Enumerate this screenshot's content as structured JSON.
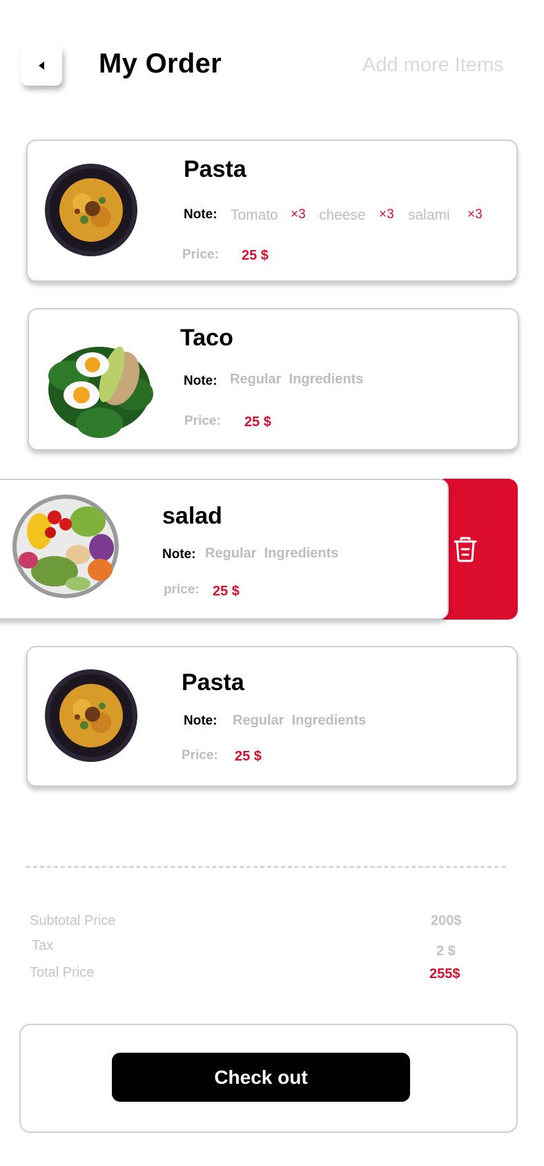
{
  "header": {
    "title": "My Order",
    "add_more_label": "Add more Items"
  },
  "orders": [
    {
      "name": "Pasta",
      "note_label": "Note:",
      "notes": [
        {
          "text": "Tomato",
          "qty": "×3"
        },
        {
          "text": "cheese",
          "qty": "×3"
        },
        {
          "text": "salami",
          "qty": "×3"
        }
      ],
      "price_label": "Price:",
      "price": "25 $"
    },
    {
      "name": "Taco",
      "note_label": "Note:",
      "note": "Regular  Ingredients",
      "price_label": "Price:",
      "price": "25 $"
    },
    {
      "name": "salad",
      "note_label": "Note:",
      "note": "Regular  Ingredients",
      "price_label": "price:",
      "price": "25 $"
    },
    {
      "name": "Pasta",
      "note_label": "Note:",
      "note": "Regular  Ingredients",
      "price_label": "Price:",
      "price": "25 $"
    }
  ],
  "summary": {
    "subtotal_label": "Subtotal Price",
    "subtotal": "200$",
    "tax_label": "Tax",
    "tax": "2 $",
    "total_label": "Total Price",
    "total": "255$"
  },
  "checkout_label": "Check out",
  "colors": {
    "accent": "#dc0c2d",
    "muted_text": "#bdbdbd",
    "button": "#000000"
  },
  "icons": {
    "back": "chevron-left-icon",
    "delete": "trash-icon"
  }
}
